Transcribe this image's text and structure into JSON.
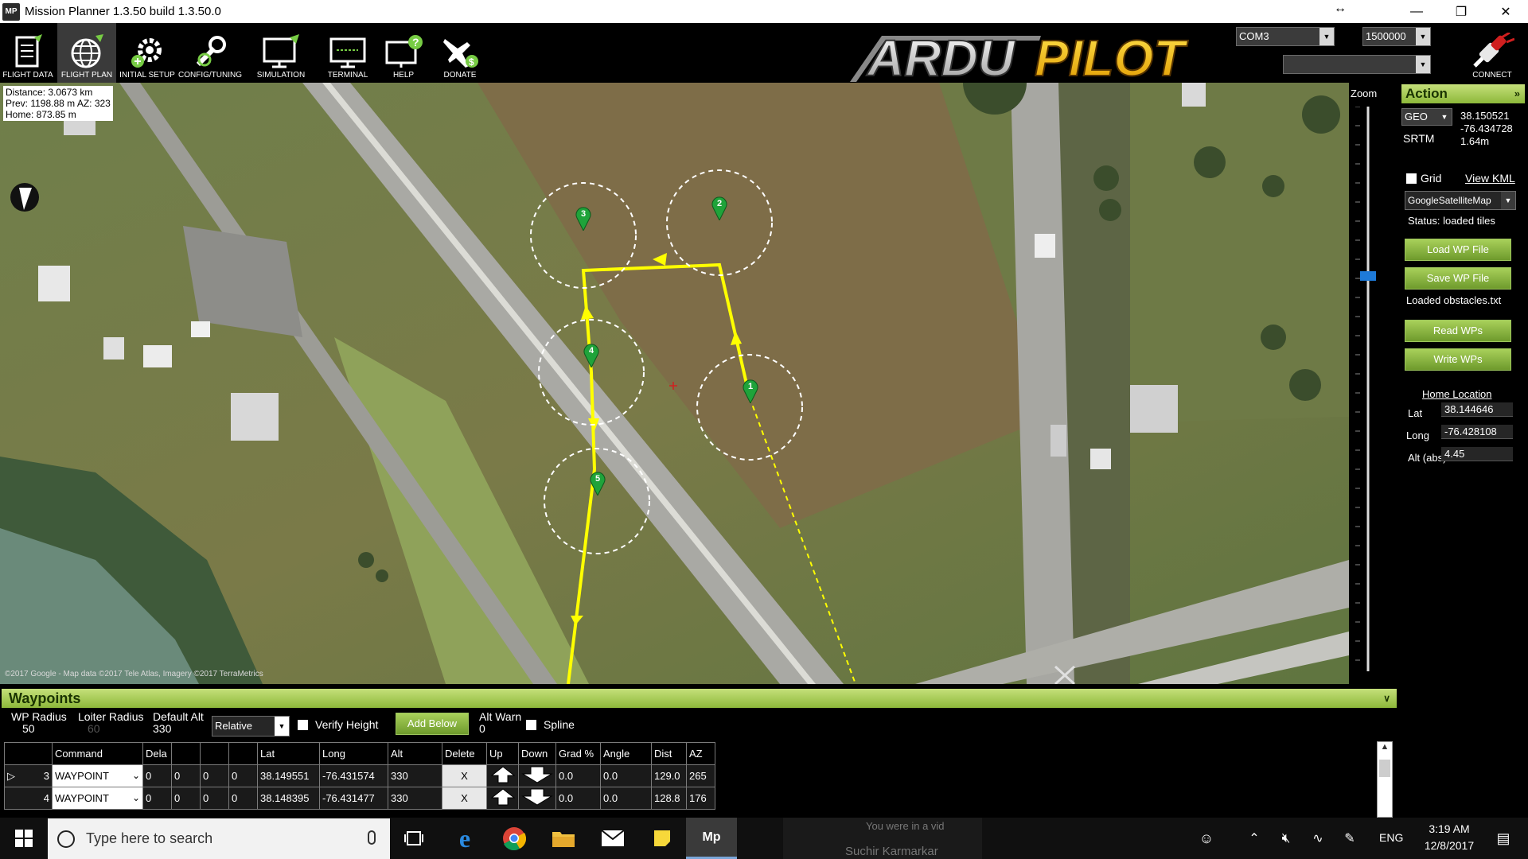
{
  "window": {
    "title": "Mission Planner 1.3.50 build 1.3.50.0",
    "icon_text": "MP",
    "restore_glyph": "↔"
  },
  "toolbar": {
    "buttons": [
      {
        "label": "FLIGHT DATA"
      },
      {
        "label": "FLIGHT PLAN"
      },
      {
        "label": "INITIAL SETUP"
      },
      {
        "label": "CONFIG/TUNING"
      },
      {
        "label": "SIMULATION"
      },
      {
        "label": "TERMINAL"
      },
      {
        "label": "HELP"
      },
      {
        "label": "DONATE"
      }
    ],
    "logo_text": "ARDUPILOT",
    "port": "COM3",
    "baud": "1500000",
    "connect_label": "CONNECT"
  },
  "map": {
    "distance": "Distance: 3.0673 km",
    "prev": "Prev: 1198.88 m AZ: 323",
    "home": "Home: 873.85 m",
    "copyright": "©2017 Google - Map data ©2017 Tele Atlas, Imagery ©2017 TerraMetrics",
    "waypoint_labels": [
      "1",
      "2",
      "3",
      "4",
      "5"
    ]
  },
  "zoom": {
    "label": "Zoom",
    "level_fraction": 0.3
  },
  "action_panel": {
    "title": "Action",
    "coord_type": "GEO",
    "lat": "38.150521",
    "lng": "-76.434728",
    "alt": "1.64m",
    "srtm": "SRTM",
    "grid_label": "Grid",
    "view_kml": "View KML",
    "map_type": "GoogleSatelliteMap",
    "status": "Status: loaded tiles",
    "load_wp": "Load WP File",
    "save_wp": "Save WP File",
    "loaded_obstacles": "Loaded obstacles.txt",
    "read_wps": "Read WPs",
    "write_wps": "Write WPs",
    "home_location": "Home Location",
    "home_lat_label": "Lat",
    "home_lat": "38.144646",
    "home_long_label": "Long",
    "home_long": "-76.428108",
    "home_alt_label": "Alt (abs)",
    "home_alt": "4.45"
  },
  "waypoints": {
    "title": "Waypoints",
    "wp_radius_label": "WP Radius",
    "wp_radius": "50",
    "loiter_radius_label": "Loiter Radius",
    "loiter_radius": "60",
    "default_alt_label": "Default Alt",
    "default_alt": "330",
    "alt_mode": "Relative",
    "verify_height": "Verify Height",
    "add_below": "Add Below",
    "alt_warn_label": "Alt Warn",
    "alt_warn": "0",
    "spline": "Spline",
    "columns": [
      "",
      "Command",
      "Dela",
      "",
      "",
      "",
      "Lat",
      "Long",
      "Alt",
      "Delete",
      "Up",
      "Down",
      "Grad %",
      "Angle",
      "Dist",
      "AZ"
    ],
    "rows": [
      {
        "num": "3",
        "cmd": "WAYPOINT",
        "p1": "0",
        "p2": "0",
        "p3": "0",
        "p4": "0",
        "lat": "38.149551",
        "lng": "-76.431574",
        "alt": "330",
        "del": "X",
        "grad": "0.0",
        "angle": "0.0",
        "dist": "129.0",
        "az": "265"
      },
      {
        "num": "4",
        "cmd": "WAYPOINT",
        "p1": "0",
        "p2": "0",
        "p3": "0",
        "p4": "0",
        "lat": "38.148395",
        "lng": "-76.431477",
        "alt": "330",
        "del": "X",
        "grad": "0.0",
        "angle": "0.0",
        "dist": "128.8",
        "az": "176"
      }
    ]
  },
  "taskbar": {
    "search_placeholder": "Type here to search",
    "notification": "You were in a vid",
    "notification_user": "Suchir Karmarkar",
    "lang": "ENG",
    "time": "3:19 AM",
    "date": "12/8/2017"
  }
}
